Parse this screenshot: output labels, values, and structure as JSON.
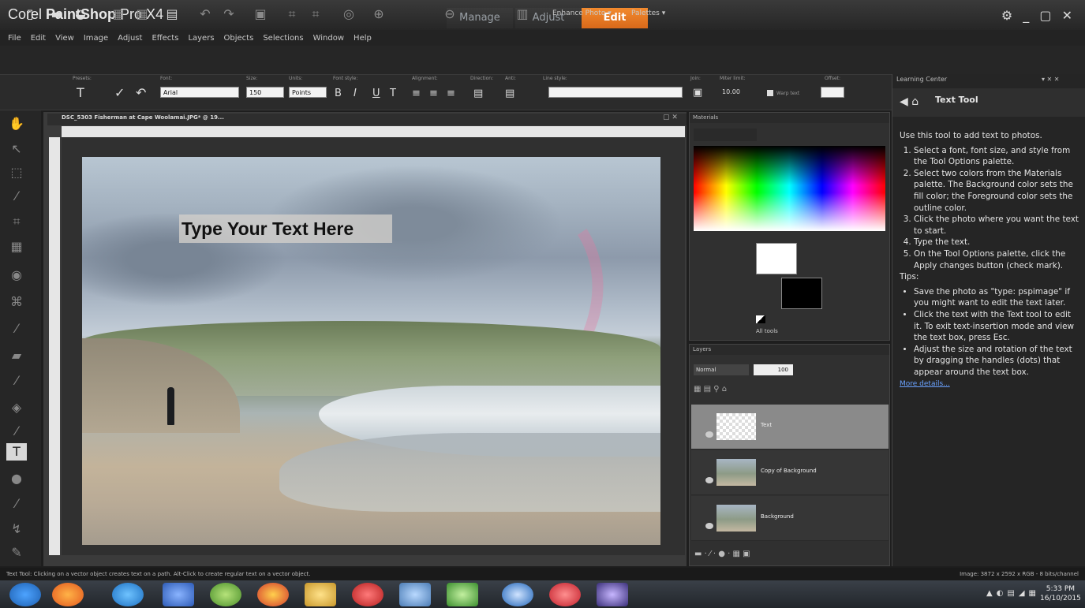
{
  "app": {
    "brand": "Corel",
    "product": "PaintShop",
    "version": "Pro X4",
    "workspace_tabs": [
      "Manage",
      "Adjust",
      "Edit"
    ],
    "active_tab": "Edit",
    "window_controls": "⚙ _ ▢ ✕"
  },
  "menu": [
    "File",
    "Edit",
    "View",
    "Image",
    "Adjust",
    "Effects",
    "Layers",
    "Objects",
    "Selections",
    "Window",
    "Help"
  ],
  "toolbar": {
    "enhance_photo": "Enhance Photo ▾",
    "palettes": "Palettes ▾"
  },
  "tool_options": {
    "presets_label": "Presets:",
    "font_label": "Font:",
    "font_value": "Arial",
    "size_label": "Size:",
    "size_value": "150",
    "units_label": "Units:",
    "units_value": "Points",
    "font_style_label": "Font style:",
    "alignment_label": "Alignment:",
    "direction_label": "Direction:",
    "anti_label": "Anti:",
    "line_style_label": "Line style:",
    "join_label": "Join:",
    "miter_label": "Miter limit:",
    "miter_value": "10.00",
    "warp_text": "Warp text",
    "offset_label": "Offset:"
  },
  "document": {
    "title": "DSC_5303 Fisherman at Cape Woolamai.JPG* @ 19...",
    "overlay_text": "Type Your Text Here"
  },
  "materials": {
    "title": "Materials",
    "all_tools": "All tools"
  },
  "layers": {
    "title": "Layers",
    "blend_mode": "Normal",
    "opacity": "100",
    "items": [
      {
        "name": "Text"
      },
      {
        "name": "Copy of Background"
      },
      {
        "name": "Background"
      }
    ]
  },
  "learning_center": {
    "header": "Learning Center",
    "controls": "▾ ✕ ✕",
    "title": "Text Tool",
    "intro": "Use this tool to add text to photos.",
    "steps": [
      "Select a font, font size, and style from the Tool Options palette.",
      "Select two colors from the Materials palette. The Background color sets the fill color; the Foreground color sets the outline color.",
      "Click the photo where you want the text to start.",
      "Type the text.",
      "On the Tool Options palette, click the Apply changes button (check mark)."
    ],
    "tips_label": "Tips:",
    "tips": [
      "Save the photo as \"type: pspimage\" if you might want to edit the text later.",
      "Click the text with the Text tool to edit it. To exit text-insertion mode and view the text box, press Esc.",
      "Adjust the size and rotation of the text by dragging the handles (dots) that appear around the text box."
    ],
    "more": "More details..."
  },
  "status": {
    "left": "Text Tool: Clicking on a vector object creates text on a path. Alt-Click to create regular text on a vector object.",
    "right": "Image: 3872 x 2592 x RGB - 8 bits/channel"
  },
  "clock": {
    "time": "5:33 PM",
    "date": "16/10/2015"
  },
  "colors": {
    "accent": "#e87a24",
    "background": "#1e1e1e"
  }
}
